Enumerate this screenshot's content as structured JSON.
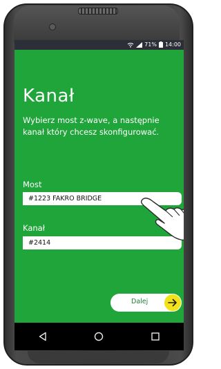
{
  "statusbar": {
    "battery_percent": "71%",
    "time": "14:00"
  },
  "screen": {
    "title": "Kanał",
    "description": "Wybierz most z-wave, a następnie kanał który chcesz skonfigurować.",
    "most_label": "Most",
    "most_value": "#1223 FAKRO BRIDGE",
    "kanal_label": "Kanał",
    "kanal_value": "#2414",
    "next_button_label": "Dalej"
  },
  "colors": {
    "screen_bg": "#20a53a",
    "accent_yellow": "#f1e21a",
    "button_text": "#1a7f33"
  },
  "icons": {
    "next": "arrow-right-icon",
    "back": "back-triangle-icon",
    "home": "home-circle-icon",
    "recent": "recent-square-icon",
    "hand": "pointing-hand-icon"
  }
}
